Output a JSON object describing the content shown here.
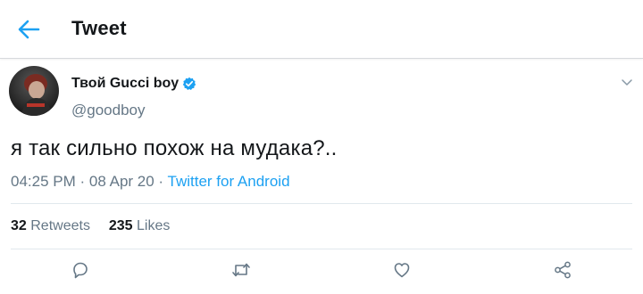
{
  "header": {
    "title": "Tweet",
    "back_icon": "arrow-left-icon"
  },
  "accent_color": "#1da1f2",
  "author": {
    "display_name": "Твой Gucci boy",
    "handle": "@goodboy",
    "verified": true
  },
  "tweet": {
    "text": "я так сильно похож на мудака?..",
    "time": "04:25 PM",
    "date": "08 Apr 20",
    "separator": "·",
    "source": "Twitter for Android"
  },
  "stats": {
    "retweets_count": "32",
    "retweets_label": "Retweets",
    "likes_count": "235",
    "likes_label": "Likes"
  },
  "actions": [
    "reply-icon",
    "retweet-icon",
    "like-icon",
    "share-icon"
  ]
}
